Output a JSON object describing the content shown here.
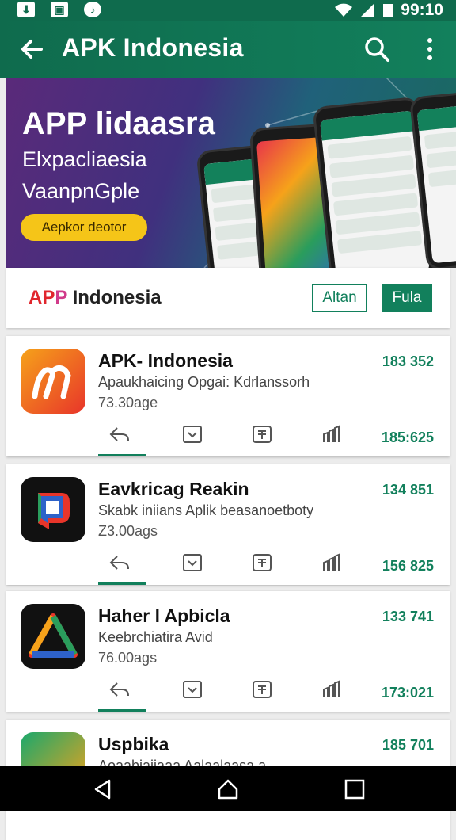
{
  "status_bar": {
    "time": "99:10"
  },
  "app_bar": {
    "title": "APK Indonesia"
  },
  "banner": {
    "title": "APP lidaasra",
    "subtitle_line1": "Elxpacliaesia",
    "subtitle_line2": "VaanpnGple",
    "cta_label": "Aepkor deotor"
  },
  "brand_bar": {
    "brand_part1": "AP",
    "brand_part2": "P",
    "brand_part3": " Indonesia",
    "button_outline_label": "Altan",
    "button_filled_label": "Fula"
  },
  "apps": [
    {
      "name": "APK- Indonesia",
      "description": "Apaukhaicing Opgai: Kdrlanssorh",
      "size": "73.30age",
      "count_top": "183 352",
      "count_bottom": "185:625",
      "icon": "orange-m-logo-icon"
    },
    {
      "name": "Eavkricag Reakin",
      "description": "Skabk iniians Aplik beasanoetboty",
      "size": "Z3.00ags",
      "count_top": "134 851",
      "count_bottom": "156 825",
      "icon": "colorful-p-logo-icon"
    },
    {
      "name": "Haher l Apbicla",
      "description": "Keebrchiatira Avid",
      "size": "76.00ags",
      "count_top": "133 741",
      "count_bottom": "173:021",
      "icon": "rainbow-triangle-logo-icon"
    },
    {
      "name": "Uspbika",
      "description": "Aoaabiaiiaaa  Aalaalaasa   a",
      "size": "",
      "count_top": "185 701",
      "count_bottom": "",
      "icon": "green-orange-logo-icon"
    }
  ],
  "colors": {
    "primary": "#12805c",
    "primary_dark": "#0f6b4d",
    "cta_yellow": "#f5c518"
  }
}
